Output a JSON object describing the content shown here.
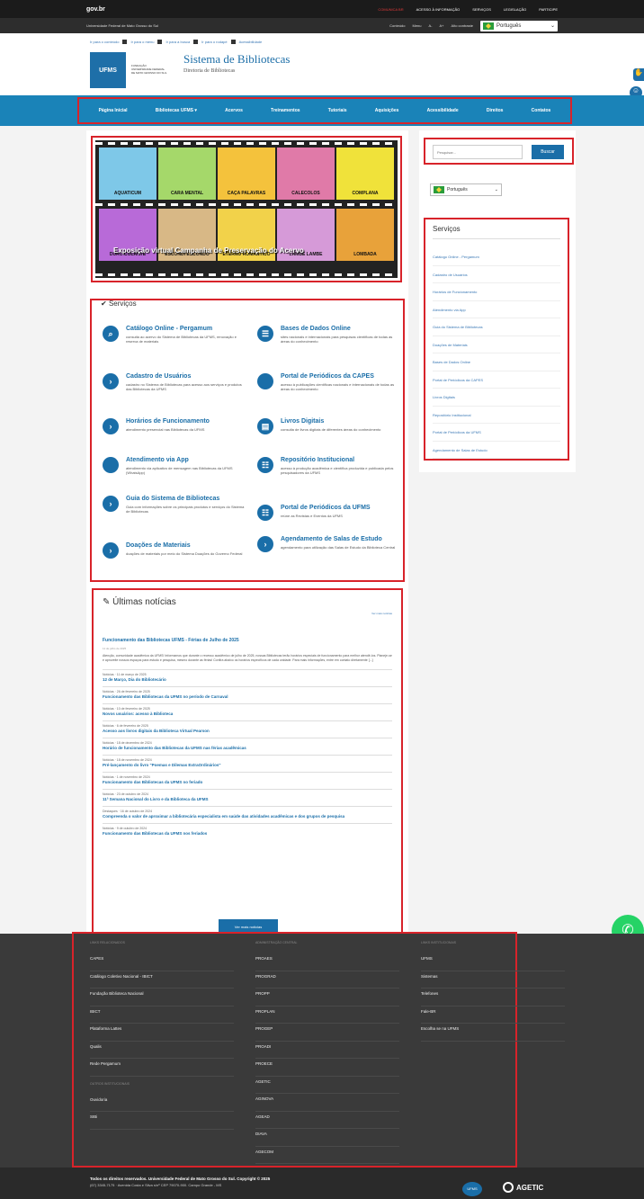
{
  "govbar": {
    "brand": "gov.br",
    "links": [
      "COMUNICA BR",
      "ACESSO À INFORMAÇÃO",
      "SERVIÇOS",
      "LEGISLAÇÃO",
      "PARTICIPE"
    ]
  },
  "accessbar": {
    "university": "Universidade Federal de Mato Grosso do Sul",
    "items": [
      "Conteúdo",
      "Menu",
      "A-",
      "A+",
      "Alto contraste"
    ],
    "language": "Português"
  },
  "breadcrumb": [
    "Ir para o conteúdo",
    "Ir para o menu",
    "Ir para a busca",
    "Ir para o rodapé",
    "Acessibilidade"
  ],
  "header": {
    "logo_label": "UFMS",
    "logo_text": "FUNDAÇÃO UNIVERSIDADE FEDERAL DE MATO GROSSO DO SUL",
    "title": "Sistema de Bibliotecas",
    "subtitle": "Diretoria de Bibliotecas"
  },
  "nav": [
    "Página Inicial",
    "Bibliotecas UFMS ▾",
    "Acervos",
    "Treinamentos",
    "Tutoriais",
    "Aquisições",
    "Acessibilidade",
    "Direitos",
    "Contatos"
  ],
  "carousel": {
    "top_tiles": [
      "Aquaticum",
      "Cara Mental",
      "Caça Palavras",
      "Calecolos",
      "Complana"
    ],
    "bottom_tiles": [
      "Duro Colante",
      "Escondi Escondo",
      "Eterno Romântico",
      "Lambe Lambe",
      "Lombada"
    ],
    "caption": "Exposição virtual Campanha de Preservação do Acervo"
  },
  "search": {
    "placeholder": "Pesquisar...",
    "button": "Buscar"
  },
  "language2": "Português",
  "services_side": {
    "title": "Serviços",
    "items": [
      "Catálogo Online - Pergamum",
      "Cadastro de Usuários",
      "Horários de Funcionamento",
      "Atendimento via App",
      "Guia do Sistema de Bibliotecas",
      "Doações de Materiais",
      "Bases de Dados Online",
      "Portal de Periódicos da CAPES",
      "Livros Digitais",
      "Repositório Institucional",
      "Portal de Periódicos da UFMS",
      "Agendamento de Salas de Estudo"
    ]
  },
  "services_main": {
    "title": "Serviços",
    "items": [
      {
        "title": "Catálogo Online - Pergamum",
        "desc": "consulta ao acervo do Sistema de Bibliotecas da UFMS, renovação e reserva de materiais"
      },
      {
        "title": "Bases de Dados Online",
        "desc": "sites nacionais e internacionais para pesquisas científicas de todas as áreas do conhecimento"
      },
      {
        "title": "Cadastro de Usuários",
        "desc": "cadastro no Sistema de Bibliotecas para acesso aos serviços e produtos das Bibliotecas da UFMS"
      },
      {
        "title": "Portal de Periódicos da CAPES",
        "desc": "acesso à publicações científicas nacionais e internacionais de todas as áreas do conhecimento"
      },
      {
        "title": "Horários de Funcionamento",
        "desc": "atendimento presencial nas Bibliotecas da UFMS"
      },
      {
        "title": "Livros Digitais",
        "desc": "consulta de livros digitais de diferentes áreas do conhecimento"
      },
      {
        "title": "Atendimento via App",
        "desc": "atendimento via aplicativo de mensagem nas Bibliotecas da UFMS (WhatsApp)"
      },
      {
        "title": "Repositório Institucional",
        "desc": "acesso à produção acadêmica e científica produzida e publicada pelos pesquisadores da UFMS"
      },
      {
        "title": "Guia do Sistema de Bibliotecas",
        "desc": "Guia com informações sobre os principais produtos e serviços do Sistema de Bibliotecas"
      },
      {
        "title": "Portal de Periódicos da UFMS",
        "desc": "reúne as Revistas e Eventos da UFMS"
      },
      {
        "title": "Doações de Materiais",
        "desc": "doações de materiais por meio do Sistema Doações do Governo Federal"
      },
      {
        "title": "Agendamento de Salas de Estudo",
        "desc": "agendamento para utilização das Salas de Estudo da Biblioteca Central"
      }
    ]
  },
  "news": {
    "title": "Últimas notícias",
    "more_top": "Ver mais notícias",
    "featured_title": "Funcionamento das Bibliotecas UFMS - Férias de Julho de 2025",
    "featured_date": "11 de julho de 2025",
    "featured_text": "Atenção, comunidade acadêmica da UFMS! Informamos que durante o recesso acadêmico de julho de 2025, nossas Bibliotecas terão horários especiais de funcionamento para melhor atendê-los. Planeje-se e aproveite nossos espaços para estudo e pesquisa, mesmo durante as férias! Confira abaixo os horários específicos de cada unidade. Para mais informações, entre em contato diretamente [...]",
    "items": [
      {
        "cat": "Notícias · 11 de março de 2025",
        "title": "12 de Março, Dia do Bibliotecário"
      },
      {
        "cat": "Notícias · 26 de fevereiro de 2025",
        "title": "Funcionamento das Bibliotecas da UFMS no período de Carnaval"
      },
      {
        "cat": "Notícias · 10 de fevereiro de 2025",
        "title": "Novos usuários: acesso à Biblioteca"
      },
      {
        "cat": "Notícias · 6 de fevereiro de 2025",
        "title": "Acesso aos livros digitais da Biblioteca Virtual Pearson"
      },
      {
        "cat": "Notícias · 18 de dezembro de 2024",
        "title": "Horário de funcionamento das Bibliotecas da UFMS nas férias acadêmicas"
      },
      {
        "cat": "Notícias · 18 de novembro de 2024",
        "title": "Pré-lançamento do livro \"Poemas e Dilemas ExtraOrdinários\""
      },
      {
        "cat": "Notícias · 1 de novembro de 2024",
        "title": "Funcionamento das Bibliotecas da UFMS no feriado"
      },
      {
        "cat": "Notícias · 23 de outubro de 2024",
        "title": "11ª Semana Nacional do Livro e da Biblioteca da UFMS"
      },
      {
        "cat": "Destaques · 16 de outubro de 2024",
        "title": "Compreenda o valor de aproximar a bibliotecária especialista em saúde das atividades acadêmicas e dos grupos de pesquisa"
      },
      {
        "cat": "Notícias · 9 de outubro de 2024",
        "title": "Funcionamento das Bibliotecas da UFMS nos feriados"
      }
    ],
    "see_all": "Ver mais notícias"
  },
  "footer": {
    "col1_title": "Links Relacionados",
    "col1": [
      "CAPES",
      "Catálogo Coletivo Nacional - IBICT",
      "Fundação Biblioteca Nacional",
      "IBICT",
      "Plataforma Lattes",
      "Qualis",
      "Rede Pergamum"
    ],
    "col1b_title": "Outros Institucionais",
    "col1b": [
      "Ouvidoria",
      "SIBi"
    ],
    "col2_title": "Administração Central",
    "col2": [
      "PROAES",
      "PROGRAD",
      "PROPP",
      "PROPLAN",
      "PROGEP",
      "PROADI",
      "PROECE",
      "AGETIC",
      "AGINOVA",
      "AGEAD",
      "DIAVA",
      "AGECOM"
    ],
    "col3_title": "Links Institucionais",
    "col3": [
      "UFMS",
      "Sistemas",
      "Telefones",
      "Fale-BR",
      "Escolha se na UFMS"
    ]
  },
  "copyright": {
    "line1": "Todos os direitos reservados. Universidade Federal de Mato Grosso do Sul. Copyright © 2025",
    "line2": "(67) 3345-7175 · Avenida Costa e Silva s/nº CEP 79070-900. Campo Grande - MS",
    "agetic": "AGETIC"
  },
  "colors": {
    "primary": "#1a6ea8",
    "nav": "#1a83b8",
    "highlight": "#d8232a",
    "footer": "#3a3a3a"
  }
}
